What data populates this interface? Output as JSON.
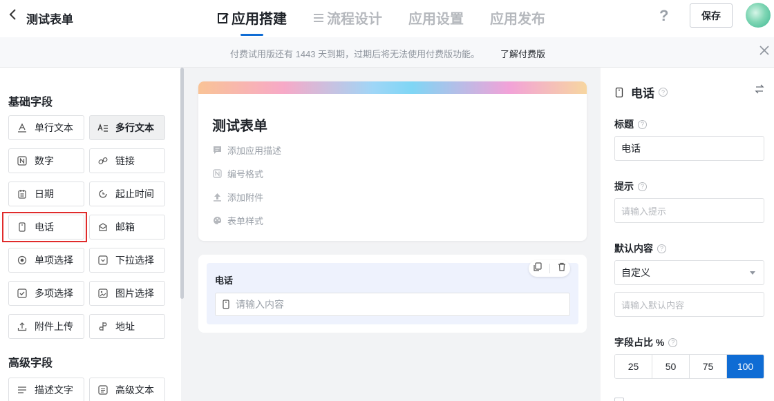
{
  "header": {
    "back_icon": "chevron-left-icon",
    "form_name": "测试表单",
    "tabs": [
      {
        "label": "应用搭建",
        "icon": "edit-icon",
        "active": true
      },
      {
        "label": "流程设计",
        "icon": "flow-icon",
        "active": false
      },
      {
        "label": "应用设置",
        "active": false
      },
      {
        "label": "应用发布",
        "active": false
      }
    ],
    "help_label": "?",
    "save_label": "保存"
  },
  "notice": {
    "text": "付费试用版还有 1443 天到期，过期后将无法使用付费版功能。",
    "link": "了解付费版"
  },
  "left": {
    "basic_title": "基础字段",
    "basic_fields": [
      {
        "label": "单行文本",
        "icon": "single-line-text-icon"
      },
      {
        "label": "多行文本",
        "icon": "multi-line-text-icon",
        "selected": true
      },
      {
        "label": "数字",
        "icon": "number-icon"
      },
      {
        "label": "链接",
        "icon": "link-icon"
      },
      {
        "label": "日期",
        "icon": "calendar-icon"
      },
      {
        "label": "起止时间",
        "icon": "time-range-icon"
      },
      {
        "label": "电话",
        "icon": "phone-icon"
      },
      {
        "label": "邮箱",
        "icon": "mail-icon"
      },
      {
        "label": "单项选择",
        "icon": "radio-icon"
      },
      {
        "label": "下拉选择",
        "icon": "dropdown-icon"
      },
      {
        "label": "多项选择",
        "icon": "checkbox-icon"
      },
      {
        "label": "图片选择",
        "icon": "image-icon"
      },
      {
        "label": "附件上传",
        "icon": "upload-icon"
      },
      {
        "label": "地址",
        "icon": "location-icon"
      }
    ],
    "advanced_title": "高级字段",
    "advanced_fields": [
      {
        "label": "描述文字",
        "icon": "description-icon"
      },
      {
        "label": "高级文本",
        "icon": "rich-text-icon"
      }
    ]
  },
  "canvas": {
    "form_title": "测试表单",
    "options": [
      {
        "label": "添加应用描述",
        "icon": "comment-icon"
      },
      {
        "label": "编号格式",
        "icon": "number-format-icon"
      },
      {
        "label": "添加附件",
        "icon": "upload-icon"
      },
      {
        "label": "表单样式",
        "icon": "palette-icon"
      }
    ],
    "field": {
      "label": "电话",
      "placeholder": "请输入内容"
    }
  },
  "props": {
    "title": "电话",
    "label_title": "标题",
    "title_value": "电话",
    "label_hint": "提示",
    "hint_placeholder": "请输入提示",
    "label_default": "默认内容",
    "default_mode": "自定义",
    "default_placeholder": "请输入默认内容",
    "label_ratio": "字段占比 %",
    "ratio_options": [
      "25",
      "50",
      "75",
      "100"
    ],
    "ratio_selected": "100"
  },
  "colors": {
    "accent": "#0f6cd4",
    "highlight": "#e02b2b"
  }
}
